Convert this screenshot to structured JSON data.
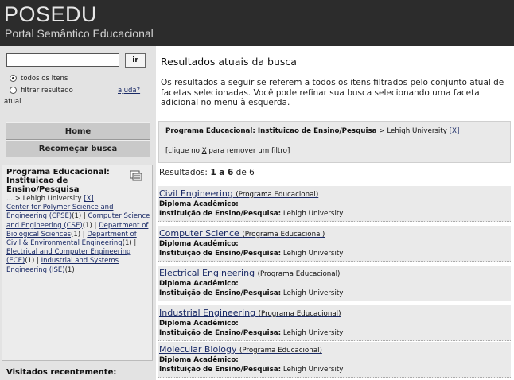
{
  "header": {
    "title": "POSEDU",
    "subtitle": "Portal Semântico Educacional"
  },
  "sidebar": {
    "search": {
      "value": "",
      "go_label": "ir"
    },
    "radio_all": {
      "label": "todos os itens",
      "selected": true
    },
    "radio_filter": {
      "label": "filtrar resultado",
      "label_cont": "atual",
      "selected": false
    },
    "help_label": "ajuda?",
    "home_label": "Home",
    "restart_label": "Recomeçar busca",
    "facet": {
      "title": "Programa Educacional: Instituicao de Ensino/Pesquisa",
      "breadcrumb_prefix": "... > Lehigh University ",
      "remove_label": "[X]",
      "options": [
        {
          "label": "Center for Polymer Science and Engineering (CPSE)",
          "count": "(1)"
        },
        {
          "label": "Computer Science and Engineering (CSE)",
          "count": "(1)"
        },
        {
          "label": "Department of Biological Sciences",
          "count": "(1)"
        },
        {
          "label": "Department of Civil & Environmental Engineering",
          "count": "(1)"
        },
        {
          "label": "Electrical and Computer Engineering (ECE)",
          "count": "(1)"
        },
        {
          "label": "Industrial and Systems Engineering (ISE)",
          "count": "(1)"
        }
      ]
    },
    "recent_label": "Visitados recentemente:"
  },
  "main": {
    "title": "Resultados atuais da busca",
    "intro": "Os resultados a seguir se referem a todos os itens filtrados pelo conjunto atual de facetas selecionadas. Você pode refinar sua busca selecionando uma faceta adicional no menu à esquerda.",
    "filter": {
      "facet": "Programa Educacional: Instituicao de Ensino/Pesquisa",
      "separator": " > ",
      "value": "Lehigh University",
      "remove_label": "[X]",
      "hint_before": "[clique no ",
      "hint_x": "X",
      "hint_after": " para remover um filtro]"
    },
    "results_summary": {
      "label": "Resultados: ",
      "range": "1 a 6",
      "of_label": " de ",
      "total": "6"
    },
    "results": [
      {
        "title": "Civil Engineering",
        "kind": "(Programa Educacional)",
        "degree_label": "Diploma Acadêmico:",
        "inst_label": "Instituição de Ensino/Pesquisa:",
        "inst_value": " Lehigh University"
      },
      {
        "title": "Computer Science",
        "kind": "(Programa Educacional)",
        "degree_label": "Diploma Acadêmico:",
        "inst_label": "Instituição de Ensino/Pesquisa:",
        "inst_value": " Lehigh University"
      },
      {
        "title": "Electrical Engineering",
        "kind": "(Programa Educacional)",
        "degree_label": "Diploma Acadêmico:",
        "inst_label": "Instituição de Ensino/Pesquisa:",
        "inst_value": " Lehigh University"
      },
      {
        "title": "Industrial Engineering",
        "kind": "(Programa Educacional)",
        "degree_label": "Diploma Acadêmico:",
        "inst_label": "Instituição de Ensino/Pesquisa:",
        "inst_value": " Lehigh University"
      },
      {
        "title": "Molecular Biology",
        "kind": "(Programa Educacional)",
        "degree_label": "Diploma Acadêmico:",
        "inst_label": "Instituição de Ensino/Pesquisa:",
        "inst_value": " Lehigh University"
      }
    ]
  }
}
